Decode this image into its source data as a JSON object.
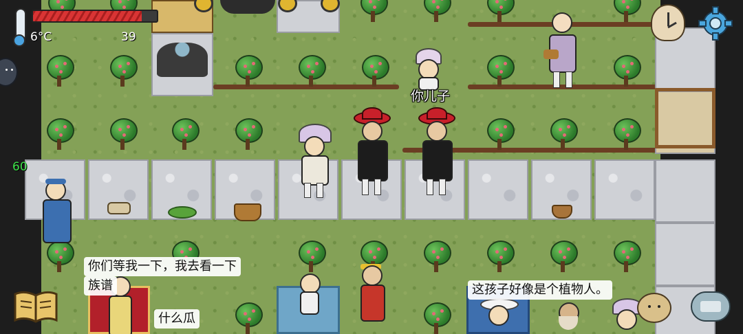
{
  "hud": {
    "temperature": "6°C",
    "food_count": "39",
    "age": "60",
    "hunger_fill": 0.88,
    "colors": {
      "hunger": "#d93434",
      "age": "#3ee24a"
    }
  },
  "icons": {
    "thermometer": "thermometer-icon",
    "clock": "clock-icon",
    "settings": "gear-icon",
    "emote": "emote-face-icon",
    "book": "book-icon",
    "keyboard": "keyboard-icon",
    "potato": "potato-face-icon"
  },
  "speech": {
    "son": "你儿子",
    "wait_line1": "你们等我一下，我去看一下",
    "wait_line2": "族谱",
    "what_melon": "什么瓜",
    "plant_person": "这孩子好像是个植物人。"
  }
}
